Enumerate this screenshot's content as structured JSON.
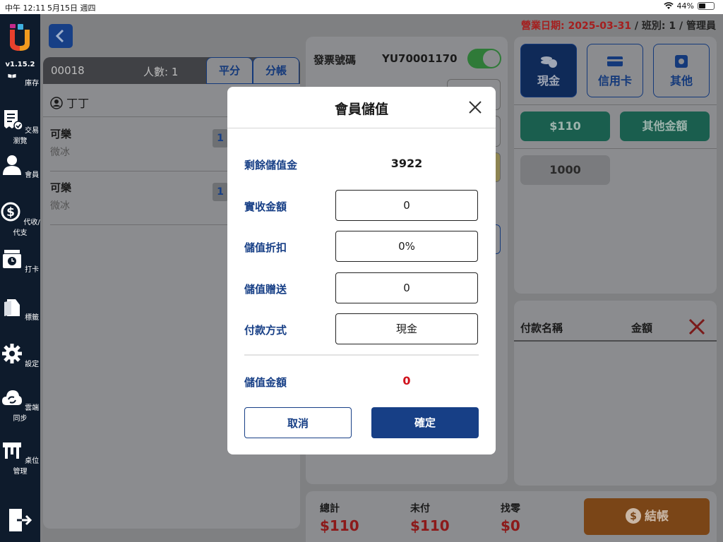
{
  "status_bar": {
    "time": "中午 12:11",
    "date": "5月15日 週四",
    "battery": "44%"
  },
  "sidebar": {
    "version": "v1.15.2",
    "items": [
      {
        "label": "庫存",
        "icon": "book-icon"
      },
      {
        "label": "交易瀏覽",
        "icon": "receipt-icon"
      },
      {
        "label": "會員",
        "icon": "person-icon"
      },
      {
        "label": "代收/代支",
        "icon": "dollar-cycle-icon"
      },
      {
        "label": "打卡",
        "icon": "clock-machine-icon"
      },
      {
        "label": "標籤",
        "icon": "tag-icon"
      },
      {
        "label": "設定",
        "icon": "gear-icon"
      },
      {
        "label": "雲端同步",
        "icon": "cloud-sync-icon"
      },
      {
        "label": "桌位管理",
        "icon": "table-icon"
      }
    ]
  },
  "header": {
    "business_date_label": "營業日期: 2025-03-31",
    "shift_info": " / 班別: 1 / 管理員"
  },
  "order": {
    "order_no": "00018",
    "people": "人數: 1",
    "tabs": [
      "平分",
      "分帳"
    ],
    "customer": "丁丁",
    "items": [
      {
        "name": "可樂",
        "note": "微冰",
        "qty": "1"
      },
      {
        "name": "可樂",
        "note": "微冰",
        "qty": "1"
      }
    ]
  },
  "invoice": {
    "label": "發票號碼",
    "number": "YU70001170"
  },
  "payment": {
    "methods": [
      {
        "label": "現金",
        "icon": "coins-icon"
      },
      {
        "label": "信用卡",
        "icon": "credit-card-icon"
      },
      {
        "label": "其他",
        "icon": "wallet-icon"
      }
    ],
    "quick_amount": "$110",
    "other_amount": "其他金額",
    "preset": "1000",
    "list_headers": {
      "name": "付款名稱",
      "amount": "金額"
    }
  },
  "totals": {
    "total_label": "總計",
    "total_value": "$110",
    "unpaid_label": "未付",
    "unpaid_value": "$110",
    "change_label": "找零",
    "change_value": "$0",
    "checkout": "結帳"
  },
  "modal": {
    "title": "會員儲值",
    "remaining_label": "剩餘儲值金",
    "remaining_value": "3922",
    "received_label": "實收金額",
    "received_value": "0",
    "discount_label": "儲值折扣",
    "discount_value": "0%",
    "bonus_label": "儲值贈送",
    "bonus_value": "0",
    "method_label": "付款方式",
    "method_value": "現金",
    "amount_label": "儲值金額",
    "amount_value": "0",
    "cancel": "取消",
    "confirm": "確定"
  },
  "colors": {
    "brand": "#173f86",
    "sidebar": "#0e1b2c",
    "accent_red": "#d0111b",
    "checkout": "#e3760f",
    "quick": "#2a9d82"
  }
}
